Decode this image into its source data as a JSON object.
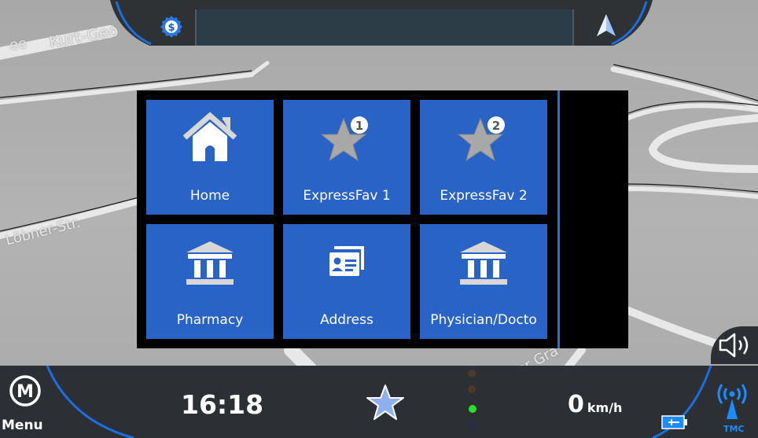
{
  "map": {
    "street_labels": [
      "Kurt-Geo",
      "ee",
      "Löbner-Str.",
      "Langer Gra",
      "-Str."
    ]
  },
  "top_bar": {
    "search_value": "",
    "settings_icon": "settings-gear-icon",
    "compass_icon": "navigation-arrow-icon"
  },
  "favorites": {
    "tiles": [
      {
        "label": "Home",
        "icon": "home-icon"
      },
      {
        "label": "ExpressFav 1",
        "icon": "star-1-icon"
      },
      {
        "label": "ExpressFav 2",
        "icon": "star-2-icon"
      },
      {
        "label": "Pharmacy",
        "icon": "building-icon"
      },
      {
        "label": "Address",
        "icon": "contact-card-icon"
      },
      {
        "label": "Physician/Docto",
        "icon": "building-icon"
      }
    ]
  },
  "bottom_bar": {
    "menu_glyph": "M",
    "menu_label": "Menu",
    "time": "16:18",
    "speed_value": "0",
    "speed_unit": "km/h",
    "tmc_label": "TMC"
  },
  "colors": {
    "tile_blue": "#2a63c6",
    "panel_black": "#000000",
    "accent_blue": "#1e6fe0",
    "gps_green": "#2ae02a"
  }
}
